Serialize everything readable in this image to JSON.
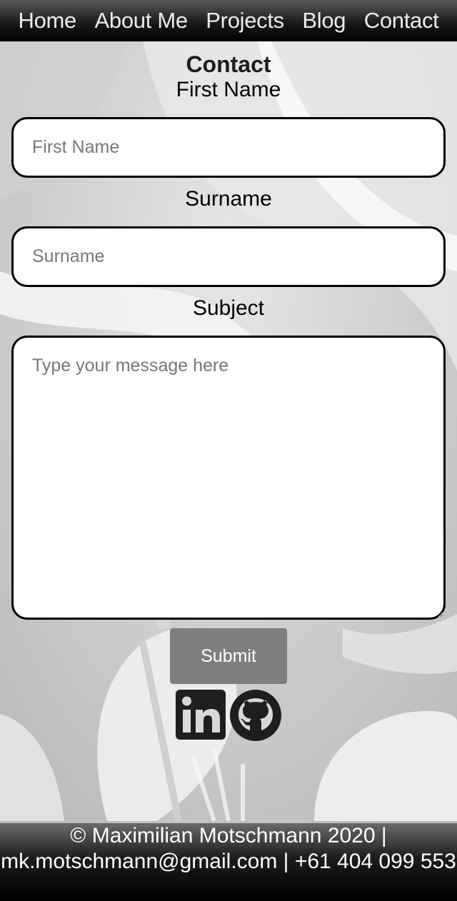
{
  "nav": {
    "items": [
      {
        "label": "Home"
      },
      {
        "label": "About Me"
      },
      {
        "label": "Projects"
      },
      {
        "label": "Blog"
      },
      {
        "label": "Contact"
      }
    ]
  },
  "main": {
    "title": "Contact",
    "first_name": {
      "label": "First Name",
      "placeholder": "First Name",
      "value": ""
    },
    "surname": {
      "label": "Surname",
      "placeholder": "Surname",
      "value": ""
    },
    "subject": {
      "label": "Subject",
      "placeholder": "Type your message here",
      "value": ""
    },
    "submit_label": "Submit"
  },
  "social": {
    "icons": [
      "linkedin-icon",
      "github-icon"
    ]
  },
  "footer": {
    "copyright": "© Maximilian Motschmann 2020",
    "separator": "|",
    "email": "mk.motschmann@gmail.com",
    "phone": "+61 404 099 553"
  },
  "colors": {
    "nav_gradient_top": "#5a5a5a",
    "nav_gradient_bottom": "#000000",
    "background": "#d4d4d4",
    "submit_button": "#7e7e7e",
    "field_border": "#000000"
  }
}
